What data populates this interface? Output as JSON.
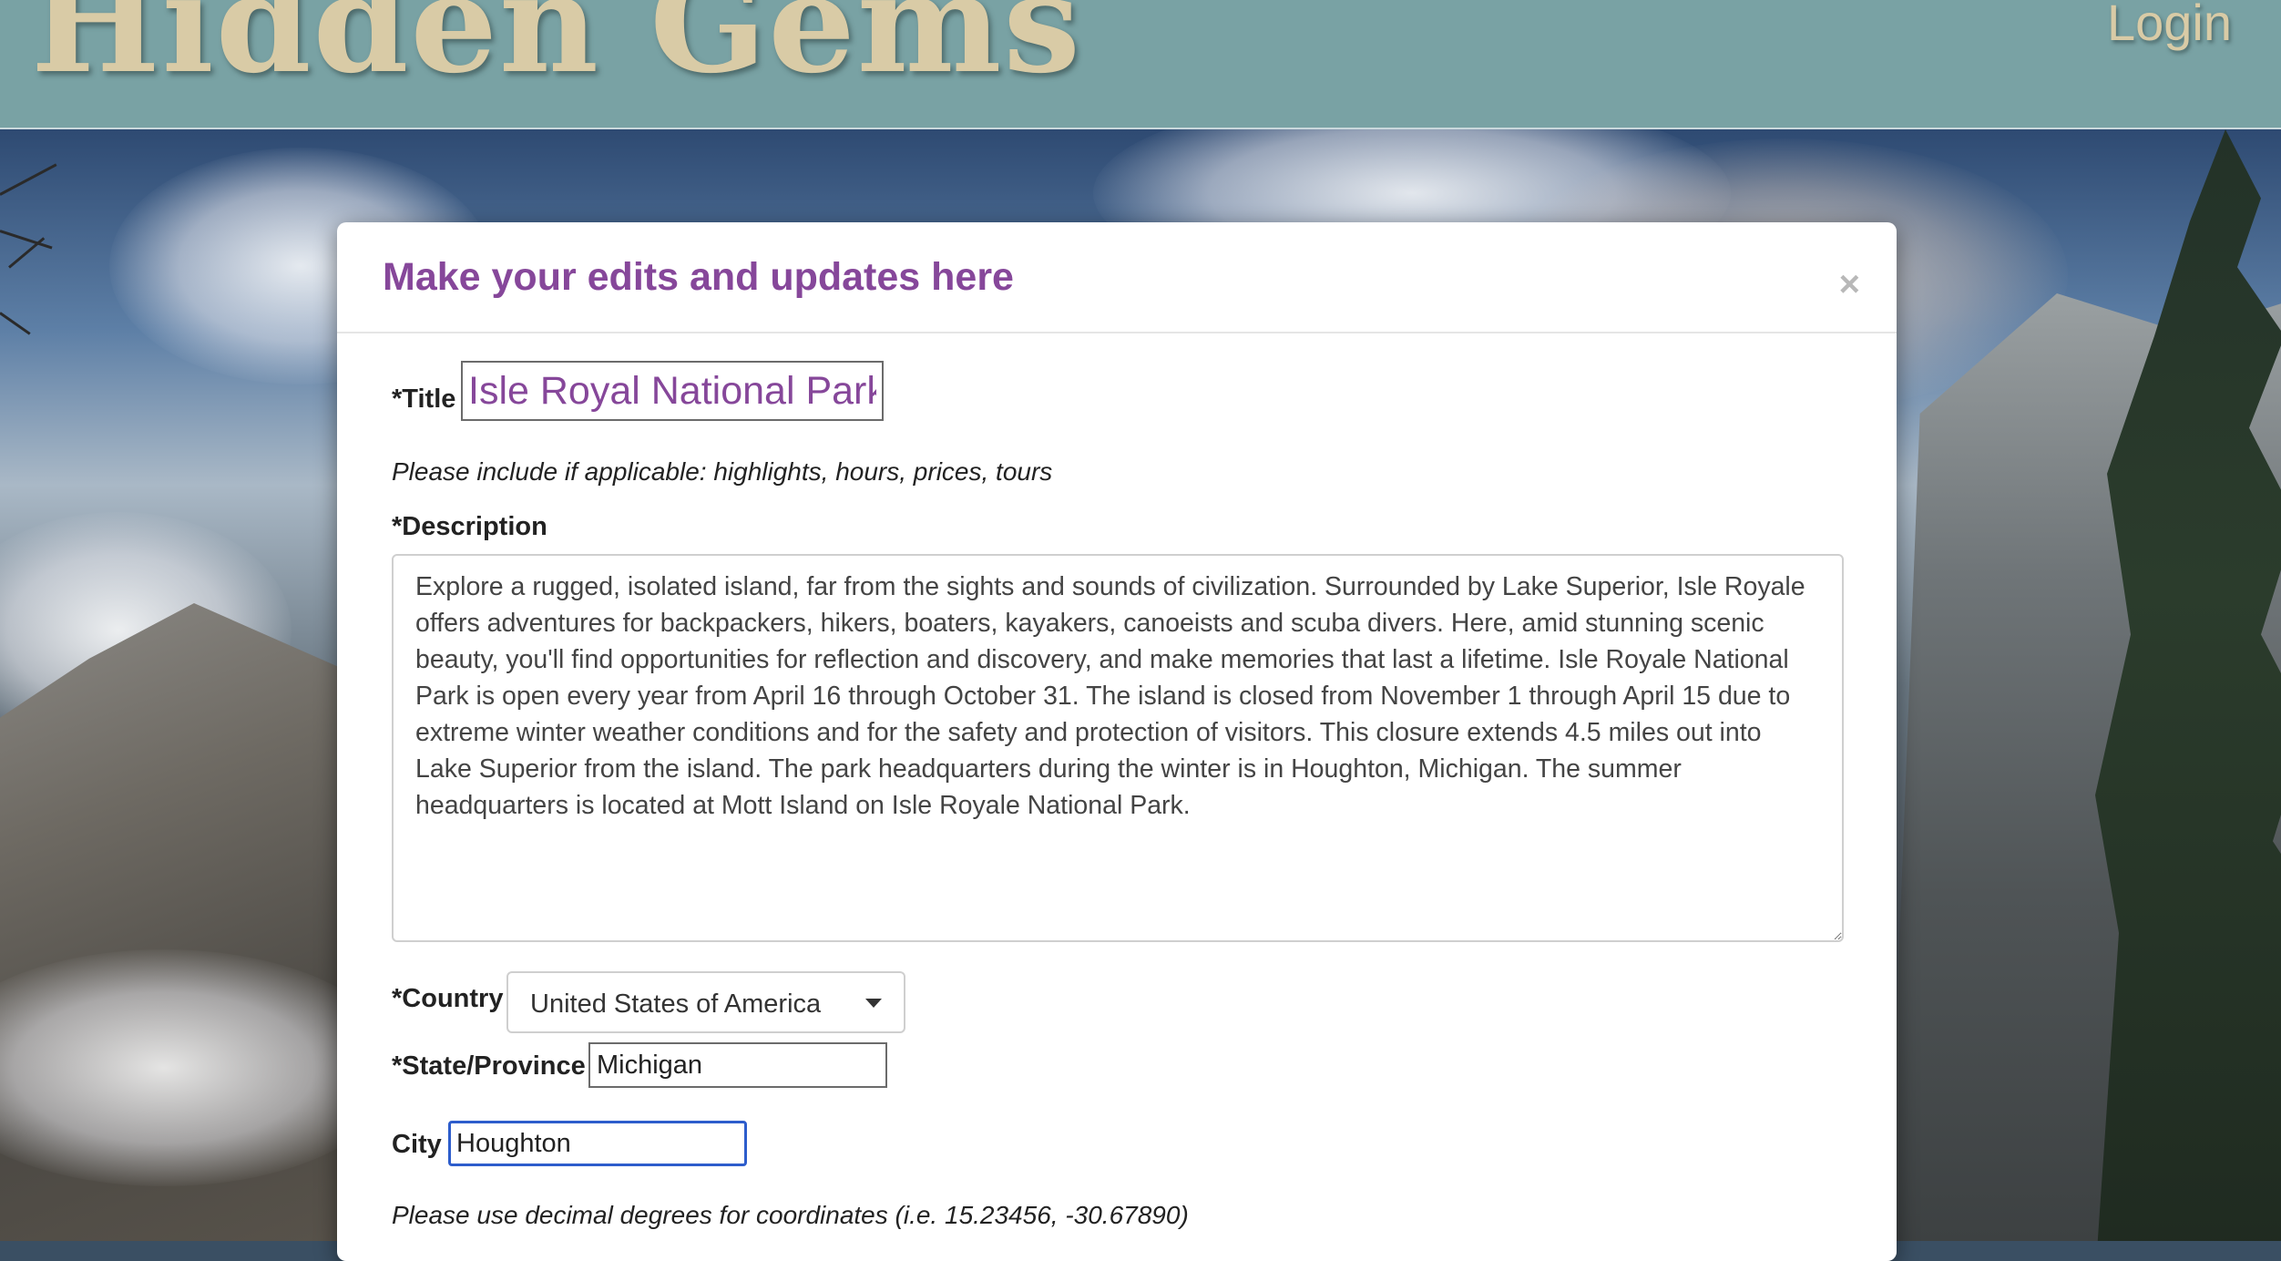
{
  "header": {
    "brand": "Hidden Gems",
    "login_label": "Login",
    "background_color": "#79a2a4",
    "brand_color": "#d9cba6"
  },
  "modal": {
    "title": "Make your edits and updates here",
    "close_icon": "×",
    "accent_color": "#86479a",
    "fields": {
      "title_label": "*Title",
      "title_value": "Isle Royal National Park",
      "description_hint": "Please include if applicable: highlights, hours, prices, tours",
      "description_label": "*Description",
      "description_value": "Explore a rugged, isolated island, far from the sights and sounds of civilization. Surrounded by Lake Superior, Isle Royale offers adventures for backpackers, hikers, boaters, kayakers, canoeists and scuba divers. Here, amid stunning scenic beauty, you'll find opportunities for reflection and discovery, and make memories that last a lifetime. Isle Royale National Park is open every year from April 16 through October 31. The island is closed from November 1 through April 15 due to extreme winter weather conditions and for the safety and protection of visitors. This closure extends 4.5 miles out into Lake Superior from the island. The park headquarters during the winter is in Houghton, Michigan. The summer headquarters is located at Mott Island on Isle Royale National Park.",
      "country_label": "*Country",
      "country_value": "United States of America",
      "state_label": "*State/Province",
      "state_value": "Michigan",
      "city_label": "City",
      "city_value": "Houghton",
      "coordinates_hint": "Please use decimal degrees for coordinates (i.e. 15.23456, -30.67890)"
    }
  }
}
